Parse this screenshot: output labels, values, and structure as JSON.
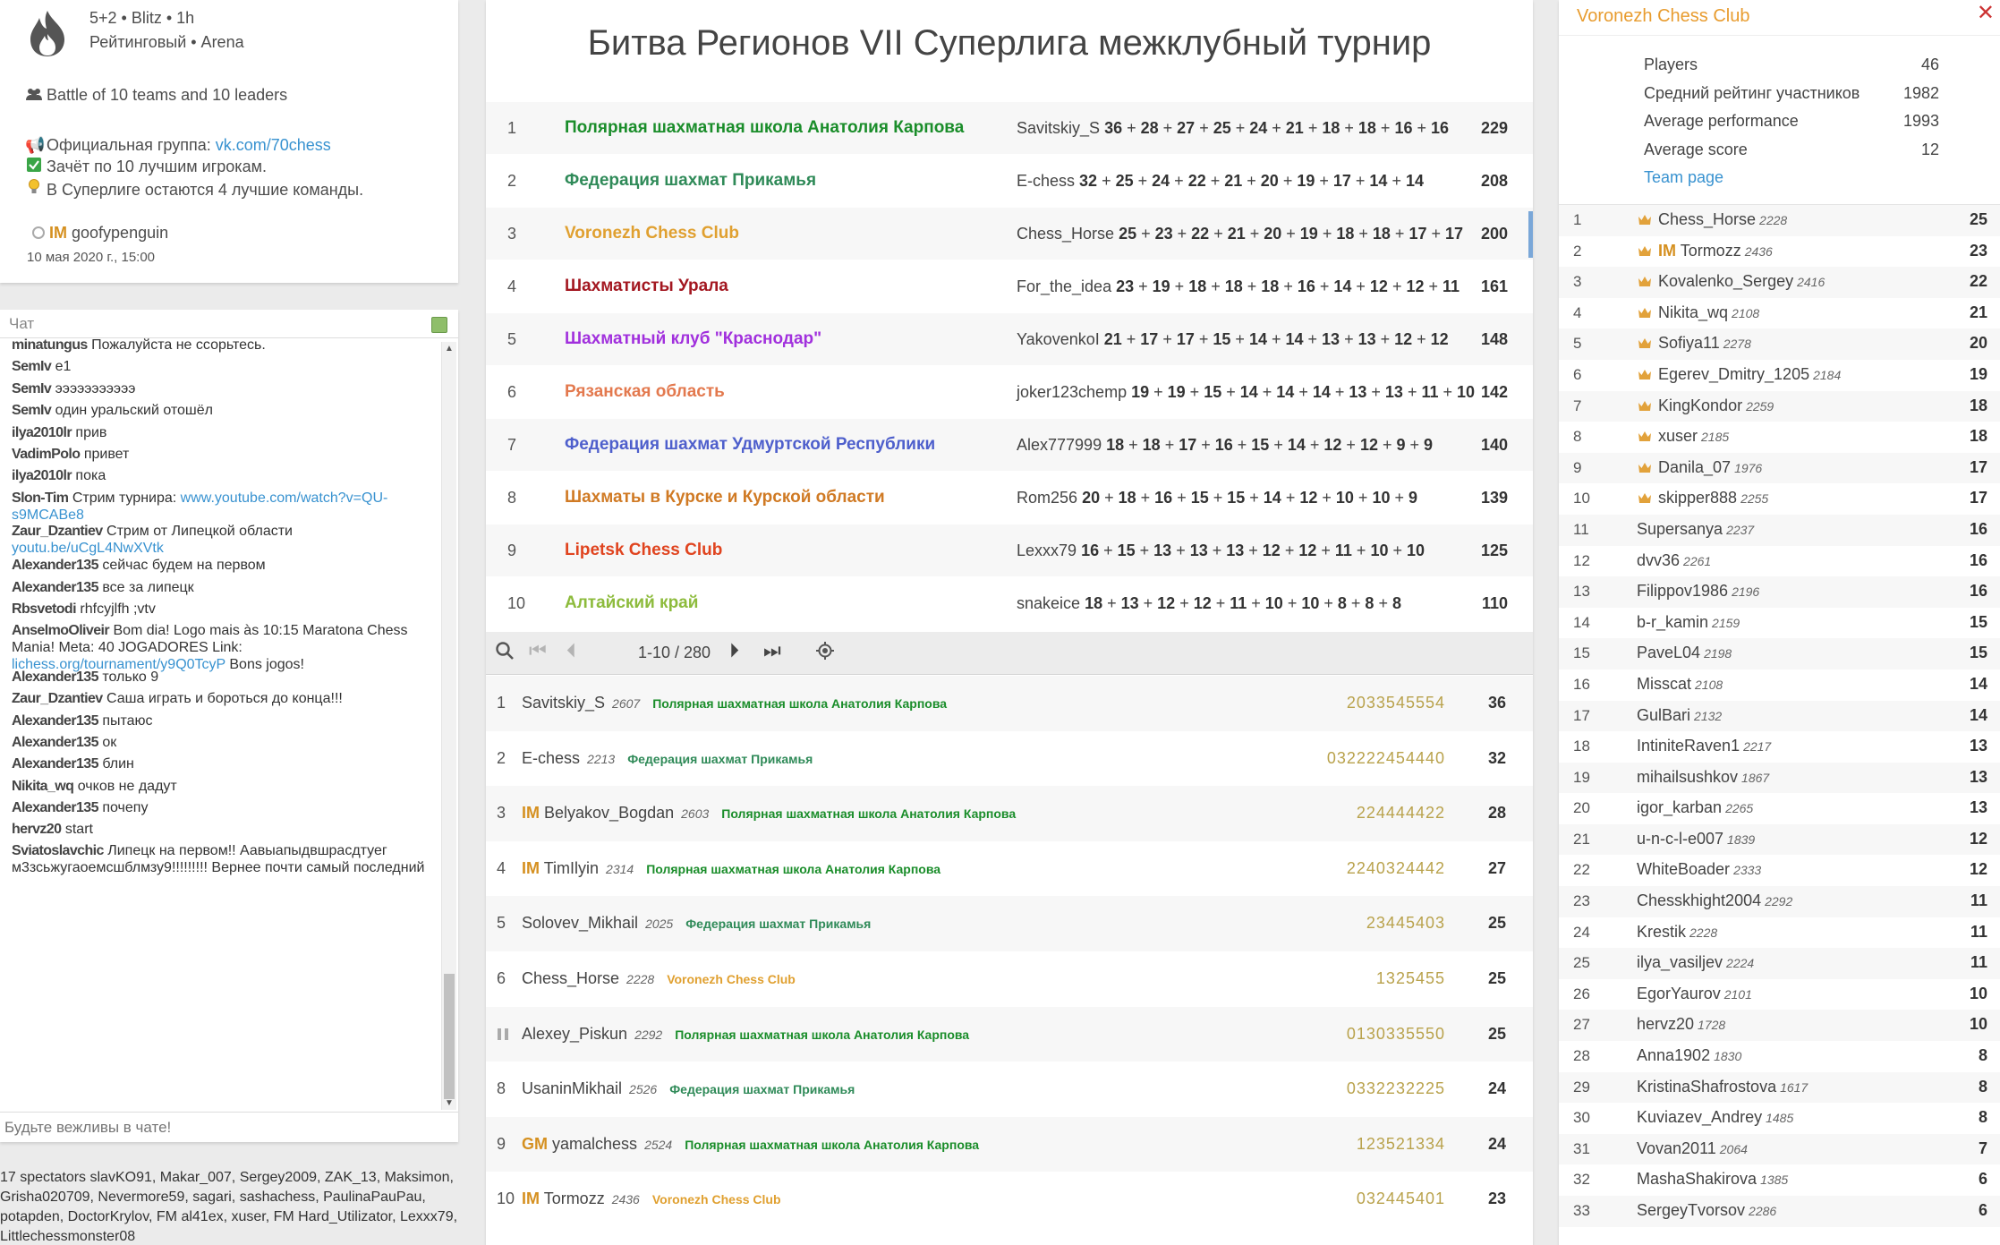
{
  "info": {
    "setup": "5+2 • Blitz • 1h",
    "mode": "Рейтинговый • Arena",
    "battle": "Battle of 10 teams and 10 leaders",
    "group_prefix": "Официальная группа: ",
    "group_link": "vk.com/70chess",
    "rule1": "Зачёт по 10 лучшим игрокам.",
    "rule2": "В Суперлиге остаются 4 лучшие команды.",
    "creator_title": "IM",
    "creator_name": "goofypenguin",
    "date": "10 мая 2020 г., 15:00"
  },
  "chat": {
    "title": "Чат",
    "placeholder": "Будьте вежливы в чате!",
    "messages": [
      {
        "user": "minatungus",
        "text": "Пожалуйста не ссорьтесь."
      },
      {
        "user": "SemIv",
        "text": "e1"
      },
      {
        "user": "SemIv",
        "text": "эээээээээээ"
      },
      {
        "user": "SemIv",
        "text": "один уральский отошёл"
      },
      {
        "user": "ilya2010lr",
        "text": "прив"
      },
      {
        "user": "VadimPolo",
        "text": "привет"
      },
      {
        "user": "ilya2010lr",
        "text": "пока"
      },
      {
        "user": "Slon-Tim",
        "text": "Стрим турнира: ",
        "link": "www.youtube.com/watch?v=QU-s9MCABe8"
      },
      {
        "user": "Zaur_Dzantiev",
        "text": "Стрим от Липецкой области ",
        "link": "youtu.be/uCgL4NwXVtk"
      },
      {
        "user": "Alexander135",
        "text": "сейчас будем на первом"
      },
      {
        "user": "Alexander135",
        "text": "все за липецк"
      },
      {
        "user": "Rbsvetodi",
        "text": "rhfcyjlfh ;vtv"
      },
      {
        "user": "AnselmoOliveir",
        "text": "Bom dia! Logo mais às 10:15 Maratona Chess Mania! Meta: 40 JOGADORES Link: ",
        "link": "lichess.org/tournament/y9Q0TcyP",
        "after": " Bons jogos!"
      },
      {
        "user": "Alexander135",
        "text": "только 9"
      },
      {
        "user": "Zaur_Dzantiev",
        "text": "Саша играть и бороться до конца!!!"
      },
      {
        "user": "Alexander135",
        "text": "пытаюс"
      },
      {
        "user": "Alexander135",
        "text": "ок"
      },
      {
        "user": "Alexander135",
        "text": "блин"
      },
      {
        "user": "Nikita_wq",
        "text": "очков не дадут"
      },
      {
        "user": "Alexander135",
        "text": "почепу"
      },
      {
        "user": "hervz20",
        "text": "start"
      },
      {
        "user": "Sviatoslavchic",
        "text": "Липецк на первом!! Аавыапыдвшрасдтуег м3зсьжугаоемсшблмзу9!!!!!!!!! Вернее почти самый последний"
      }
    ]
  },
  "spectators": "17 spectators slavKO91, Makar_007, Sergey2009, ZAK_13, Maksimon, Grisha020709, Nevermore59, sagari, sashachess, PaulinaPauPau, potapden, DoctorKrylov, FM al41ex, xuser, FM Hard_Utilizator, Lexxx79, Littlechessmonster08",
  "tournament": {
    "title": "Битва Регионов VII Суперлига межклубный турнир",
    "teams": [
      {
        "rank": "1",
        "name": "Полярная шахматная школа Анатолия Карпова",
        "color": "#1a8d2a",
        "leader": "Savitskiy_S",
        "scores": [
          "36",
          "28",
          "27",
          "25",
          "24",
          "21",
          "18",
          "18",
          "16",
          "16"
        ],
        "total": "229"
      },
      {
        "rank": "2",
        "name": "Федерация шахмат Прикамья",
        "color": "#2f8a58",
        "leader": "E-chess",
        "scores": [
          "32",
          "25",
          "24",
          "22",
          "21",
          "20",
          "19",
          "17",
          "14",
          "14"
        ],
        "total": "208"
      },
      {
        "rank": "3",
        "name": "Voronezh Chess Club",
        "color": "#e0a030",
        "leader": "Chess_Horse",
        "scores": [
          "25",
          "23",
          "22",
          "21",
          "20",
          "19",
          "18",
          "18",
          "17",
          "17"
        ],
        "total": "200",
        "mine": true
      },
      {
        "rank": "4",
        "name": "Шахматисты Урала",
        "color": "#a31720",
        "leader": "For_the_idea",
        "scores": [
          "23",
          "19",
          "18",
          "18",
          "18",
          "16",
          "14",
          "12",
          "12",
          "11"
        ],
        "total": "161"
      },
      {
        "rank": "5",
        "name": "Шахматный клуб \"Краснодар\"",
        "color": "#a130dd",
        "leader": "YakovenkoI",
        "scores": [
          "21",
          "17",
          "17",
          "15",
          "14",
          "14",
          "13",
          "13",
          "12",
          "12"
        ],
        "total": "148"
      },
      {
        "rank": "6",
        "name": "Рязанская область",
        "color": "#e3794e",
        "leader": "joker123chemp",
        "scores": [
          "19",
          "19",
          "15",
          "14",
          "14",
          "14",
          "13",
          "13",
          "11",
          "10"
        ],
        "total": "142"
      },
      {
        "rank": "7",
        "name": "Федерация шахмат Удмуртской Республики",
        "color": "#4e5fcc",
        "leader": "Alex777999",
        "scores": [
          "18",
          "18",
          "17",
          "16",
          "15",
          "14",
          "12",
          "12",
          "9",
          "9"
        ],
        "total": "140"
      },
      {
        "rank": "8",
        "name": "Шахматы в Курске и Курской области",
        "color": "#d07a24",
        "leader": "Rom256",
        "scores": [
          "20",
          "18",
          "16",
          "15",
          "15",
          "14",
          "12",
          "10",
          "10",
          "9"
        ],
        "total": "139"
      },
      {
        "rank": "9",
        "name": "Lipetsk Chess Club",
        "color": "#e0441f",
        "leader": "Lexxx79",
        "scores": [
          "16",
          "15",
          "13",
          "13",
          "13",
          "12",
          "12",
          "11",
          "10",
          "10"
        ],
        "total": "125"
      },
      {
        "rank": "10",
        "name": "Алтайский край",
        "color": "#8dbb3c",
        "leader": "snakeice",
        "scores": [
          "18",
          "13",
          "12",
          "12",
          "11",
          "10",
          "10",
          "8",
          "8",
          "8"
        ],
        "total": "110"
      }
    ],
    "pager": "1-10 / 280",
    "players": [
      {
        "rank": "1",
        "title": "",
        "name": "Savitskiy_S",
        "rating": "2607",
        "team": "Полярная шахматная школа Анатолия Карпова",
        "color": "#1a8d2a",
        "sheet": "2033545554",
        "score": "36"
      },
      {
        "rank": "2",
        "title": "",
        "name": "E-chess",
        "rating": "2213",
        "team": "Федерация шахмат Прикамья",
        "color": "#2f8a58",
        "sheet": "032222454440",
        "score": "32"
      },
      {
        "rank": "3",
        "title": "IM",
        "name": "Belyakov_Bogdan",
        "rating": "2603",
        "team": "Полярная шахматная школа Анатолия Карпова",
        "color": "#1a8d2a",
        "sheet": "224444422",
        "score": "28"
      },
      {
        "rank": "4",
        "title": "IM",
        "name": "TimIlyin",
        "rating": "2314",
        "team": "Полярная шахматная школа Анатолия Карпова",
        "color": "#1a8d2a",
        "sheet": "2240324442",
        "score": "27"
      },
      {
        "rank": "5",
        "title": "",
        "name": "Solovev_Mikhail",
        "rating": "2025",
        "team": "Федерация шахмат Прикамья",
        "color": "#2f8a58",
        "sheet": "23445403",
        "score": "25"
      },
      {
        "rank": "6",
        "title": "",
        "name": "Chess_Horse",
        "rating": "2228",
        "team": "Voronezh Chess Club",
        "color": "#e0a030",
        "sheet": "1325455",
        "score": "25"
      },
      {
        "rank": "",
        "paused": true,
        "title": "",
        "name": "Alexey_Piskun",
        "rating": "2292",
        "team": "Полярная шахматная школа Анатолия Карпова",
        "color": "#1a8d2a",
        "sheet": "0130335550",
        "score": "25"
      },
      {
        "rank": "8",
        "title": "",
        "name": "UsaninMikhail",
        "rating": "2526",
        "team": "Федерация шахмат Прикамья",
        "color": "#2f8a58",
        "sheet": "0332232225",
        "score": "24"
      },
      {
        "rank": "9",
        "title": "GM",
        "name": "yamalchess",
        "rating": "2524",
        "team": "Полярная шахматная школа Анатолия Карпова",
        "color": "#1a8d2a",
        "sheet": "123521334",
        "score": "24"
      },
      {
        "rank": "10",
        "title": "IM",
        "name": "Tormozz",
        "rating": "2436",
        "team": "Voronezh Chess Club",
        "color": "#e0a030",
        "sheet": "032445401",
        "score": "23"
      }
    ]
  },
  "team_panel": {
    "title": "Voronezh Chess Club",
    "stats": [
      {
        "label": "Players",
        "value": "46"
      },
      {
        "label": "Средний рейтинг участников",
        "value": "1982"
      },
      {
        "label": "Average performance",
        "value": "1993"
      },
      {
        "label": "Average score",
        "value": "12"
      }
    ],
    "team_page": "Team page",
    "players": [
      {
        "rank": "1",
        "title": "",
        "name": "Chess_Horse",
        "rating": "2228",
        "score": "25",
        "leader": true
      },
      {
        "rank": "2",
        "title": "IM",
        "name": "Tormozz",
        "rating": "2436",
        "score": "23",
        "leader": true
      },
      {
        "rank": "3",
        "title": "",
        "name": "Kovalenko_Sergey",
        "rating": "2416",
        "score": "22",
        "leader": true
      },
      {
        "rank": "4",
        "title": "",
        "name": "Nikita_wq",
        "rating": "2108",
        "score": "21",
        "leader": true
      },
      {
        "rank": "5",
        "title": "",
        "name": "Sofiya11",
        "rating": "2278",
        "score": "20",
        "leader": true
      },
      {
        "rank": "6",
        "title": "",
        "name": "Egerev_Dmitry_1205",
        "rating": "2184",
        "score": "19",
        "leader": true
      },
      {
        "rank": "7",
        "title": "",
        "name": "KingKondor",
        "rating": "2259",
        "score": "18",
        "leader": true
      },
      {
        "rank": "8",
        "title": "",
        "name": "xuser",
        "rating": "2185",
        "score": "18",
        "leader": true
      },
      {
        "rank": "9",
        "title": "",
        "name": "Danila_07",
        "rating": "1976",
        "score": "17",
        "leader": true
      },
      {
        "rank": "10",
        "title": "",
        "name": "skipper888",
        "rating": "2255",
        "score": "17",
        "leader": true
      },
      {
        "rank": "11",
        "title": "",
        "name": "Supersanya",
        "rating": "2237",
        "score": "16"
      },
      {
        "rank": "12",
        "title": "",
        "name": "dvv36",
        "rating": "2261",
        "score": "16"
      },
      {
        "rank": "13",
        "title": "",
        "name": "Filippov1986",
        "rating": "2196",
        "score": "16"
      },
      {
        "rank": "14",
        "title": "",
        "name": "b-r_kamin",
        "rating": "2159",
        "score": "15"
      },
      {
        "rank": "15",
        "title": "",
        "name": "PaveL04",
        "rating": "2198",
        "score": "15"
      },
      {
        "rank": "16",
        "title": "",
        "name": "Misscat",
        "rating": "2108",
        "score": "14"
      },
      {
        "rank": "17",
        "title": "",
        "name": "GulBari",
        "rating": "2132",
        "score": "14"
      },
      {
        "rank": "18",
        "title": "",
        "name": "IntiniteRaven1",
        "rating": "2217",
        "score": "13"
      },
      {
        "rank": "19",
        "title": "",
        "name": "mihailsushkov",
        "rating": "1867",
        "score": "13"
      },
      {
        "rank": "20",
        "title": "",
        "name": "igor_karban",
        "rating": "2265",
        "score": "13"
      },
      {
        "rank": "21",
        "title": "",
        "name": "u-n-c-l-e007",
        "rating": "1839",
        "score": "12"
      },
      {
        "rank": "22",
        "title": "",
        "name": "WhiteBoader",
        "rating": "2333",
        "score": "12"
      },
      {
        "rank": "23",
        "title": "",
        "name": "Chesskhight2004",
        "rating": "2292",
        "score": "11"
      },
      {
        "rank": "24",
        "title": "",
        "name": "Krestik",
        "rating": "2228",
        "score": "11"
      },
      {
        "rank": "25",
        "title": "",
        "name": "ilya_vasiljev",
        "rating": "2224",
        "score": "11"
      },
      {
        "rank": "26",
        "title": "",
        "name": "EgorYaurov",
        "rating": "2101",
        "score": "10"
      },
      {
        "rank": "27",
        "title": "",
        "name": "hervz20",
        "rating": "1728",
        "score": "10"
      },
      {
        "rank": "28",
        "title": "",
        "name": "Anna1902",
        "rating": "1830",
        "score": "8"
      },
      {
        "rank": "29",
        "title": "",
        "name": "KristinaShafrostova",
        "rating": "1617",
        "score": "8"
      },
      {
        "rank": "30",
        "title": "",
        "name": "Kuviazev_Andrey",
        "rating": "1485",
        "score": "8"
      },
      {
        "rank": "31",
        "title": "",
        "name": "Vovan2011",
        "rating": "2064",
        "score": "7"
      },
      {
        "rank": "32",
        "title": "",
        "name": "MashaShakirova",
        "rating": "1385",
        "score": "6"
      },
      {
        "rank": "33",
        "title": "",
        "name": "SergeyTvorsov",
        "rating": "2286",
        "score": "6"
      }
    ]
  }
}
